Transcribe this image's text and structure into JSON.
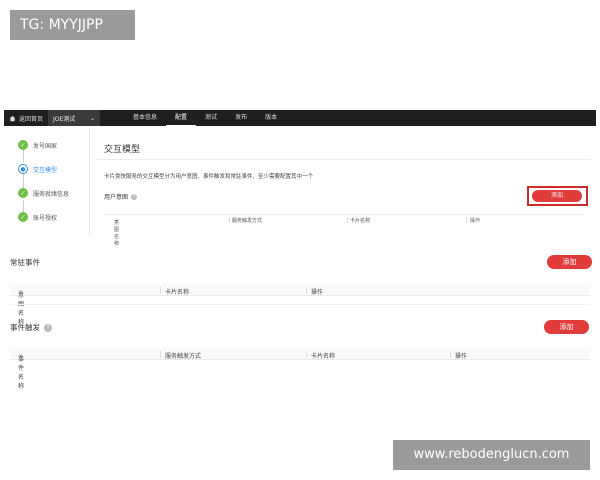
{
  "watermarks": {
    "top": "TG: MYYJJPP",
    "bottom": "www.rebodenglucn.com"
  },
  "topbar": {
    "home_label": "返回首页",
    "project_label": "JOE测试",
    "tabs": [
      "基本信息",
      "配置",
      "测试",
      "发布",
      "版本"
    ],
    "active_tab": "配置"
  },
  "sidebar": {
    "steps": [
      {
        "label": "发号国家",
        "state": "done"
      },
      {
        "label": "交互模型",
        "state": "current"
      },
      {
        "label": "服务就绪信息",
        "state": "done"
      },
      {
        "label": "账号授权",
        "state": "done"
      }
    ]
  },
  "upper_panel": {
    "title": "交互模型",
    "description": "卡片类快服务的交互模型分为用户意图、事件触发和常驻事件，至少需要配置其中一个",
    "subsection": "用户意图",
    "add_label": "添加",
    "columns": [
      "意图名称",
      "服务触发方式",
      "卡片名称",
      "操作"
    ]
  },
  "resident_events": {
    "title": "常驻事件",
    "add_label": "添加",
    "columns": [
      "意图名称",
      "卡片名称",
      "操作"
    ]
  },
  "event_trigger": {
    "title": "事件触发",
    "add_label": "添加",
    "columns": [
      "事件名称",
      "服务触发方式",
      "卡片名称",
      "操作"
    ]
  },
  "colors": {
    "accent_red": "#e23b3b",
    "done_green": "#6fbf4a",
    "current_blue": "#3a8ee6",
    "topbar": "#1f1f1f"
  }
}
